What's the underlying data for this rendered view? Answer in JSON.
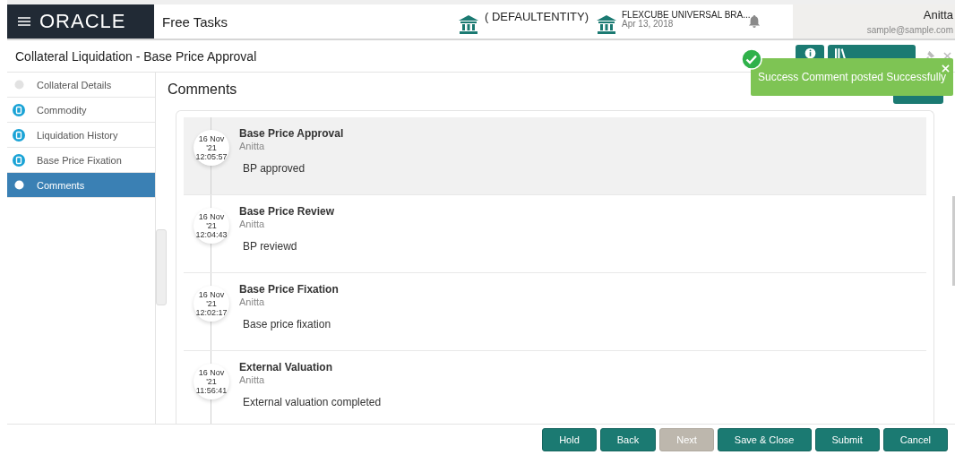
{
  "header": {
    "logo": "ORACLE",
    "title": "Free Tasks",
    "entity": "( DEFAULTENTITY)",
    "branch": "FLEXCUBE UNIVERSAL BRA...",
    "date": "Apr 13, 2018",
    "user": "Anitta",
    "email": "sample@sample.com"
  },
  "page_title": "Collateral Liquidation - Base Price Approval",
  "toast": {
    "message": "Success Comment posted Successfully"
  },
  "sidebar": {
    "items": [
      {
        "label": "Collateral Details",
        "visited": false,
        "selected": false
      },
      {
        "label": "Commodity",
        "visited": true,
        "selected": false
      },
      {
        "label": "Liquidation History",
        "visited": true,
        "selected": false
      },
      {
        "label": "Base Price Fixation",
        "visited": true,
        "selected": false
      },
      {
        "label": "Comments",
        "visited": false,
        "selected": true
      }
    ]
  },
  "content": {
    "heading": "Comments",
    "comments": [
      {
        "day": "16 Nov",
        "year": "'21",
        "time": "12:05:57",
        "title": "Base Price Approval",
        "author": "Anitta",
        "text": "BP approved",
        "selected": true
      },
      {
        "day": "16 Nov",
        "year": "'21",
        "time": "12:04:43",
        "title": "Base Price Review",
        "author": "Anitta",
        "text": "BP reviewd",
        "selected": false
      },
      {
        "day": "16 Nov",
        "year": "'21",
        "time": "12:02:17",
        "title": "Base Price Fixation",
        "author": "Anitta",
        "text": "Base price fixation",
        "selected": false
      },
      {
        "day": "16 Nov",
        "year": "'21",
        "time": "11:56:41",
        "title": "External Valuation",
        "author": "Anitta",
        "text": "External valuation completed",
        "selected": false
      }
    ]
  },
  "buttons": [
    {
      "label": "Hold",
      "disabled": false
    },
    {
      "label": "Back",
      "disabled": false
    },
    {
      "label": "Next",
      "disabled": true
    },
    {
      "label": "Save & Close",
      "disabled": false
    },
    {
      "label": "Submit",
      "disabled": false
    },
    {
      "label": "Cancel",
      "disabled": false
    }
  ]
}
